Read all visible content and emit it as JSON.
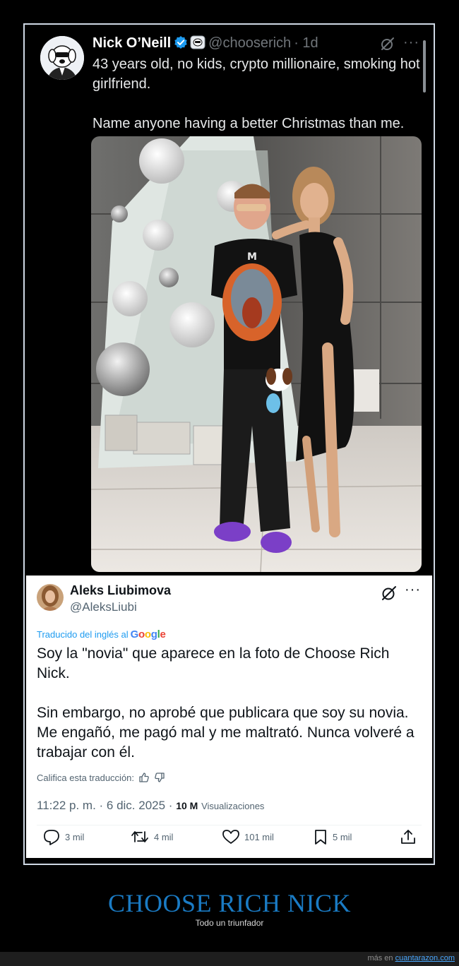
{
  "tweet1": {
    "name": "Nick O’Neill",
    "handle": "@chooserich",
    "time": "· 1d",
    "text": "43 years old, no kids, crypto millionaire, smoking hot girlfriend.\n\nName anyone having a better Christmas than me.",
    "icons": [
      "verified-badge-icon",
      "org-badge-icon",
      "grok-icon",
      "more-icon"
    ]
  },
  "tweet2": {
    "name": "Aleks Liubimova",
    "handle": "@AleksLiubi",
    "translated_prefix": "Traducido del inglés al",
    "translated_brand": "Google",
    "text": "Soy la \"novia\" que aparece en la foto de Choose Rich Nick.\n\nSin embargo, no aprobé que publicara que soy su novia. Me engañó, me pagó mal y me maltrató. Nunca volveré a trabajar con él.",
    "rate_label": "Califica esta traducción:",
    "timestamp": "11:22 p. m. · 6 dic. 2025 ·",
    "views_count": "10 M",
    "views_label": "Visualizaciones",
    "replies": "3 mil",
    "reposts": "4 mil",
    "likes": "101 mil",
    "bookmarks": "5 mil"
  },
  "footer": {
    "title": "CHOOSE RICH NICK",
    "subtitle": "Todo un triunfador",
    "more_prefix": "más en",
    "more_link": "cuantarazon.com"
  },
  "colors": {
    "caption": "#1a7bc4",
    "link": "#1d9bf0",
    "verified": "#1d9bf0",
    "google_blue": "#4285f4",
    "google_red": "#ea4335",
    "google_yellow": "#fbbc05",
    "google_green": "#34a853"
  }
}
